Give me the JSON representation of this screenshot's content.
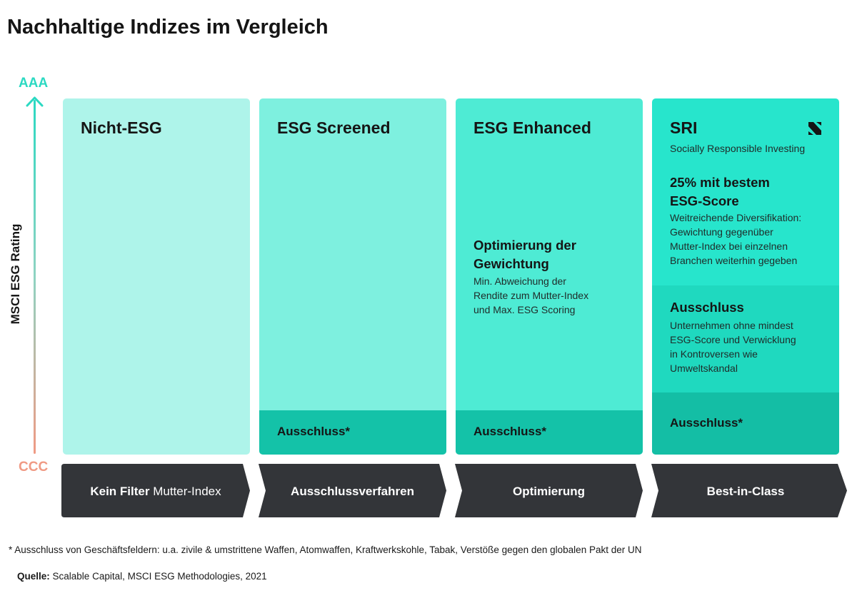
{
  "title": "Nachhaltige Indizes im Vergleich",
  "axis": {
    "top_label": "AAA",
    "bottom_label": "CCC",
    "label": "MSCI ESG Rating",
    "colors": {
      "top": "#2bd9c2",
      "bottom": "#f09a84"
    }
  },
  "columns": [
    {
      "title": "Nicht-ESG",
      "color": "#aef4ea"
    },
    {
      "title": "ESG Screened",
      "color": "#7ef0df",
      "exclusion": "Ausschluss*",
      "exclusion_color": "#14c2a8"
    },
    {
      "title": "ESG Enhanced",
      "color": "#4eebd4",
      "block_title_1": "Optimierung der",
      "block_title_2": "Gewichtung",
      "block_lines": [
        "Min. Abweichung der",
        "Rendite zum Mutter-Index",
        "und Max. ESG Scoring"
      ],
      "exclusion": "Ausschluss*",
      "exclusion_color": "#14c2a8"
    },
    {
      "title": "SRI",
      "subtitle": "Socially Responsible Investing",
      "logo": "scalable-s-logo",
      "color": "#27e5cc",
      "best_title_1": "25% mit bestem",
      "best_title_2": "ESG-Score",
      "best_lines": [
        "Weitreichende Diversifikation:",
        "Gewichtung gegenüber",
        "Mutter-Index bei einzelnen",
        "Branchen weiterhin gegeben"
      ],
      "mid_title": "Ausschluss",
      "mid_color": "#1fd9bf",
      "mid_lines": [
        "Unternehmen ohne mindest",
        "ESG-Score und Verwicklung",
        "in Kontroversen wie",
        "Umweltskandal"
      ],
      "exclusion": "Ausschluss*",
      "exclusion_color": "#14bea5"
    }
  ],
  "filters": {
    "color": "#333539",
    "items": [
      {
        "bold": "Kein Filter",
        "regular": "Mutter-Index"
      },
      {
        "bold": "Ausschlussverfahren"
      },
      {
        "bold": "Optimierung"
      },
      {
        "bold": "Best-in-Class"
      }
    ]
  },
  "footnote": "* Ausschluss von Geschäftsfeldern: u.a. zivile & umstrittene Waffen, Atomwaffen, Kraftwerkskohle, Tabak, Verstöße gegen den globalen Pakt der UN",
  "source": {
    "label": "Quelle:",
    "text": "Scalable Capital, MSCI ESG Methodologies, 2021"
  }
}
